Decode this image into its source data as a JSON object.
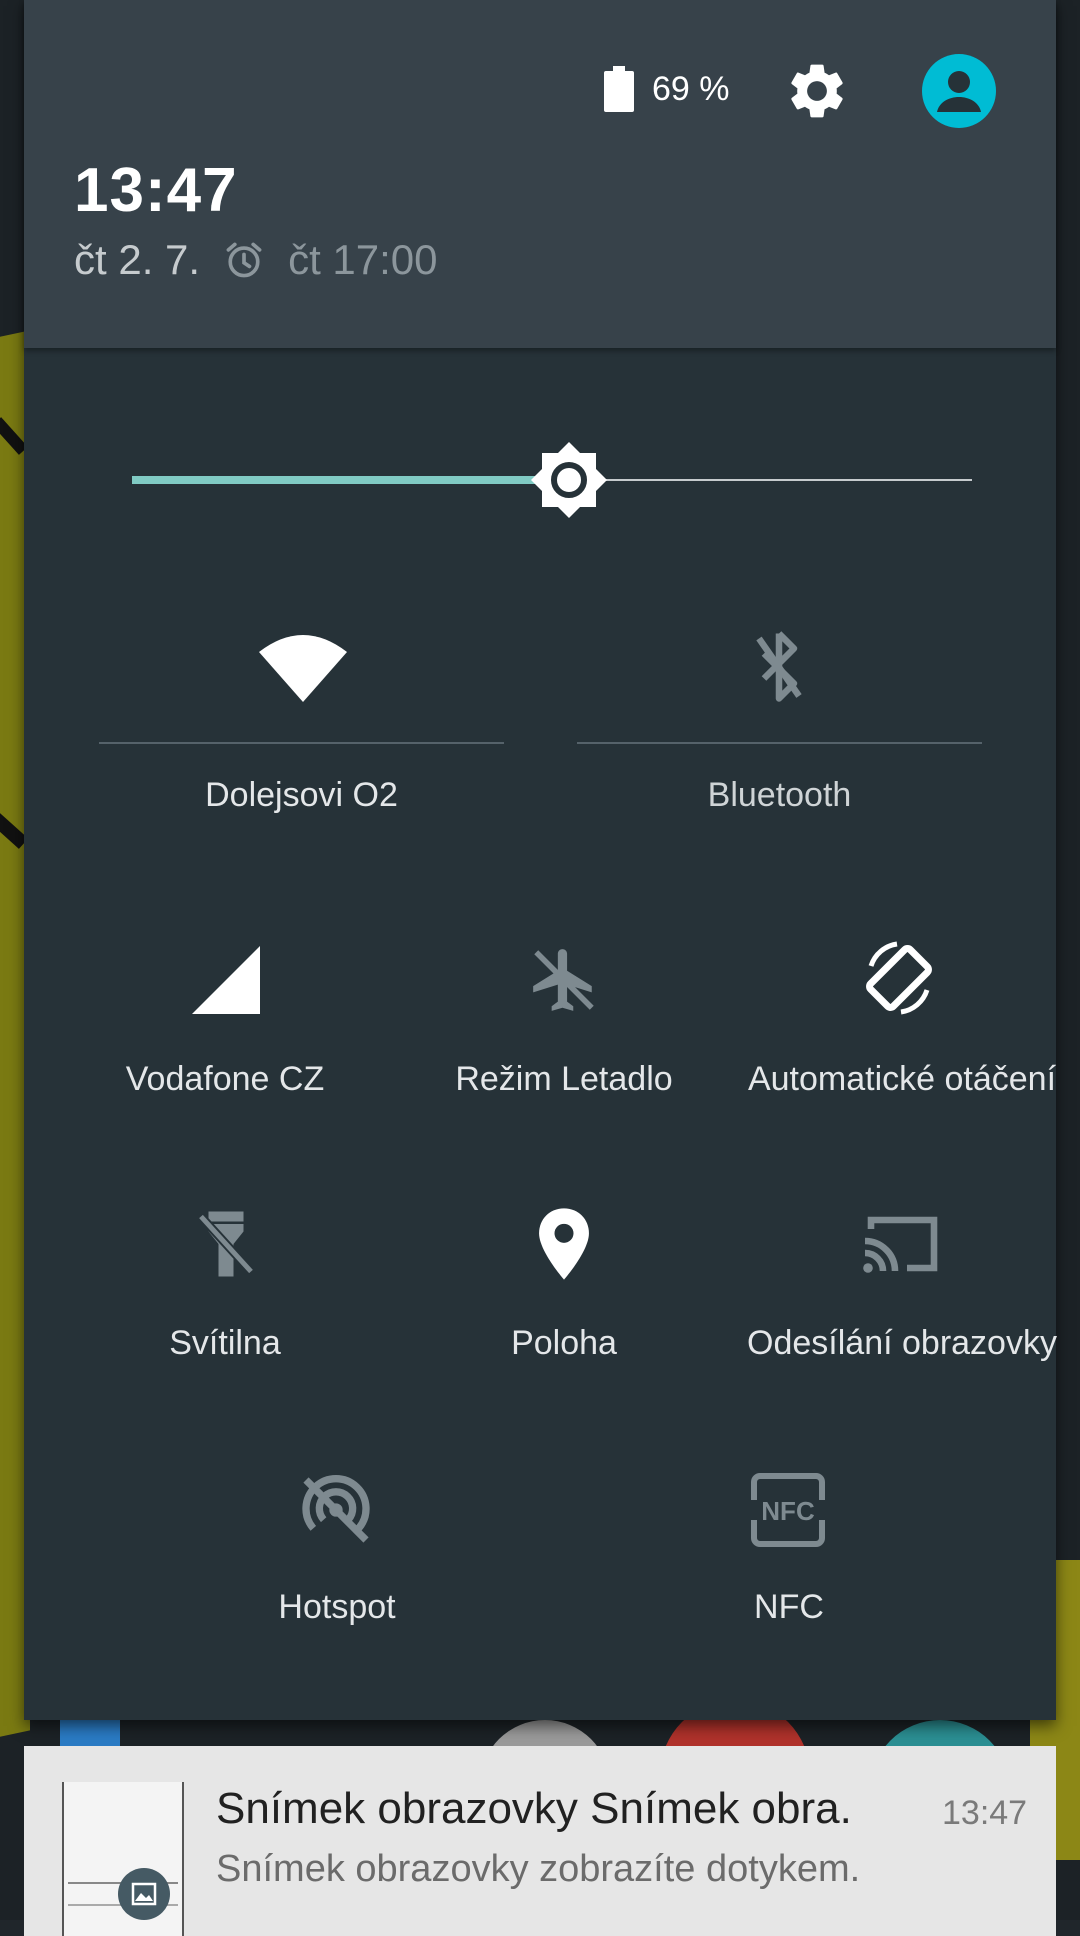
{
  "status": {
    "battery_percent": "69 %",
    "clock": "13:47",
    "date": "čt 2. 7.",
    "alarm": "čt 17:00"
  },
  "icons": {
    "battery": "battery-icon",
    "settings": "gear-icon",
    "user": "avatar-icon",
    "alarm": "alarm-clock-icon",
    "brightness": "brightness-icon"
  },
  "brightness": {
    "level": 0.52
  },
  "tiles": {
    "wifi": {
      "label": "Dolejsovi O2",
      "icon": "wifi-icon",
      "active": true
    },
    "bluetooth": {
      "label": "Bluetooth",
      "icon": "bluetooth-off-icon",
      "active": false
    },
    "cellular": {
      "label": "Vodafone CZ",
      "icon": "signal-icon",
      "active": true
    },
    "airplane": {
      "label": "Režim Letadlo",
      "icon": "airplane-icon",
      "active": false
    },
    "rotation": {
      "label": "Automatické otáčení",
      "icon": "rotate-icon",
      "active": true
    },
    "flashlight": {
      "label": "Svítilna",
      "icon": "flashlight-icon",
      "active": false
    },
    "location": {
      "label": "Poloha",
      "icon": "location-pin-icon",
      "active": true
    },
    "cast": {
      "label": "Odesílání obrazovky",
      "icon": "cast-icon",
      "active": false
    },
    "hotspot": {
      "label": "Hotspot",
      "icon": "hotspot-off-icon",
      "active": false
    },
    "nfc": {
      "label": "NFC",
      "icon": "nfc-icon",
      "active": false
    }
  },
  "notification": {
    "title": "Snímek obrazovky Snímek obra.",
    "text": "Snímek obrazovky zobrazíte dotykem.",
    "time": "13:47",
    "icon": "image-icon"
  },
  "colors": {
    "shade_bg": "#263238",
    "header_bg": "#37424a",
    "accent_teal": "#80cbc4",
    "avatar": "#00bcd4",
    "inactive_icon": "#7e8a90"
  }
}
